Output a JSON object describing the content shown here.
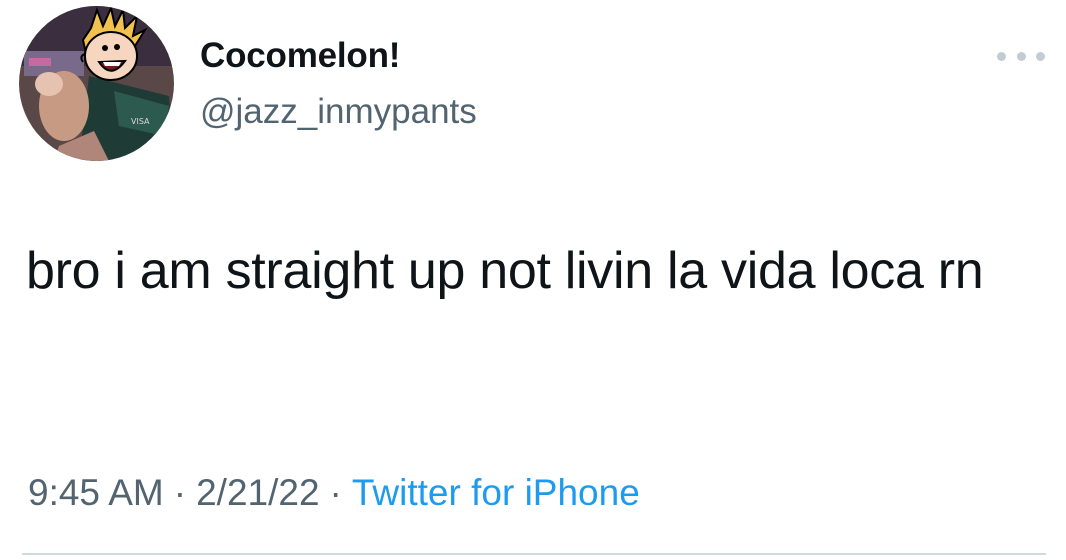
{
  "author": {
    "display_name": "Cocomelon!",
    "handle": "@jazz_inmypants",
    "avatar_icon": "cartoon-avatar-icon"
  },
  "tweet": {
    "text": "bro i am straight up not livin la vida loca rn"
  },
  "meta": {
    "time": "9:45 AM",
    "separator": "·",
    "date": "2/21/22",
    "source": "Twitter for iPhone"
  },
  "colors": {
    "text": "#0f1419",
    "secondary": "#536471",
    "link": "#1d9bf0",
    "divider": "#cfd9de"
  }
}
